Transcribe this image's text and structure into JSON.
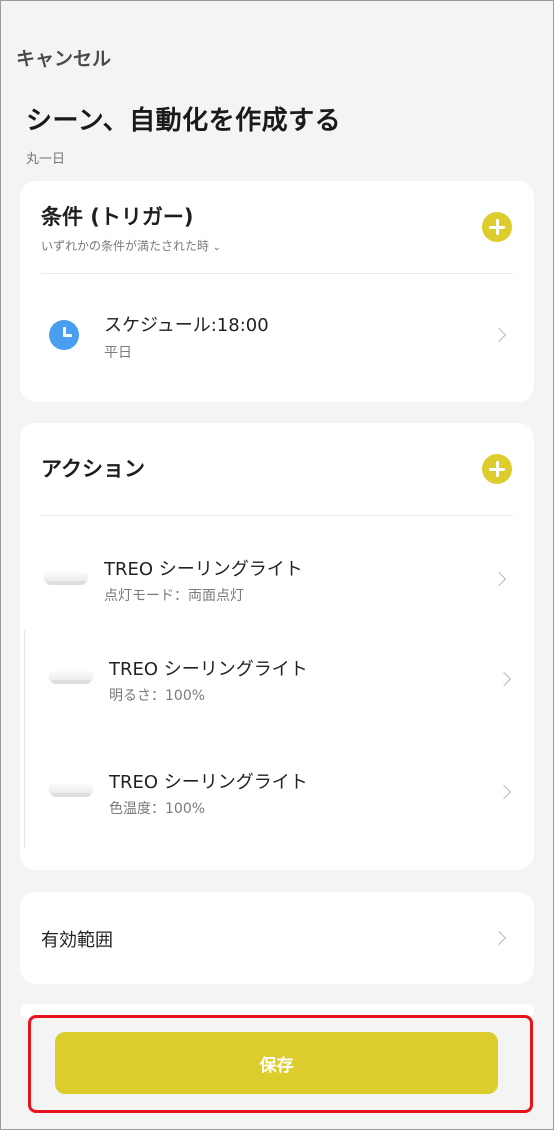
{
  "header": {
    "cancel_label": "キャンセル",
    "title": "シーン、自動化を作成する",
    "subtitle": "丸一日"
  },
  "conditions": {
    "title": "条件 (トリガー)",
    "mode_label": "いずれかの条件が満たされた時",
    "mode_caret": "⌄",
    "items": [
      {
        "icon": "clock-icon",
        "title": "スケジュール:18:00",
        "subtitle": "平日"
      }
    ]
  },
  "actions": {
    "title": "アクション",
    "items": [
      {
        "icon": "ceiling-light-icon",
        "title": "TREO シーリングライト",
        "subtitle": "点灯モード：両面点灯"
      },
      {
        "icon": "ceiling-light-icon",
        "title": "TREO シーリングライト",
        "subtitle": "明るさ：100%"
      },
      {
        "icon": "ceiling-light-icon",
        "title": "TREO シーリングライト",
        "subtitle": "色温度：100%"
      }
    ]
  },
  "range": {
    "label": "有効範囲"
  },
  "footer": {
    "save_label": "保存"
  },
  "colors": {
    "accent": "#dccd2c",
    "clock_blue": "#4a9ef0",
    "highlight_border": "#e8141c",
    "background": "#f4f4f4"
  }
}
